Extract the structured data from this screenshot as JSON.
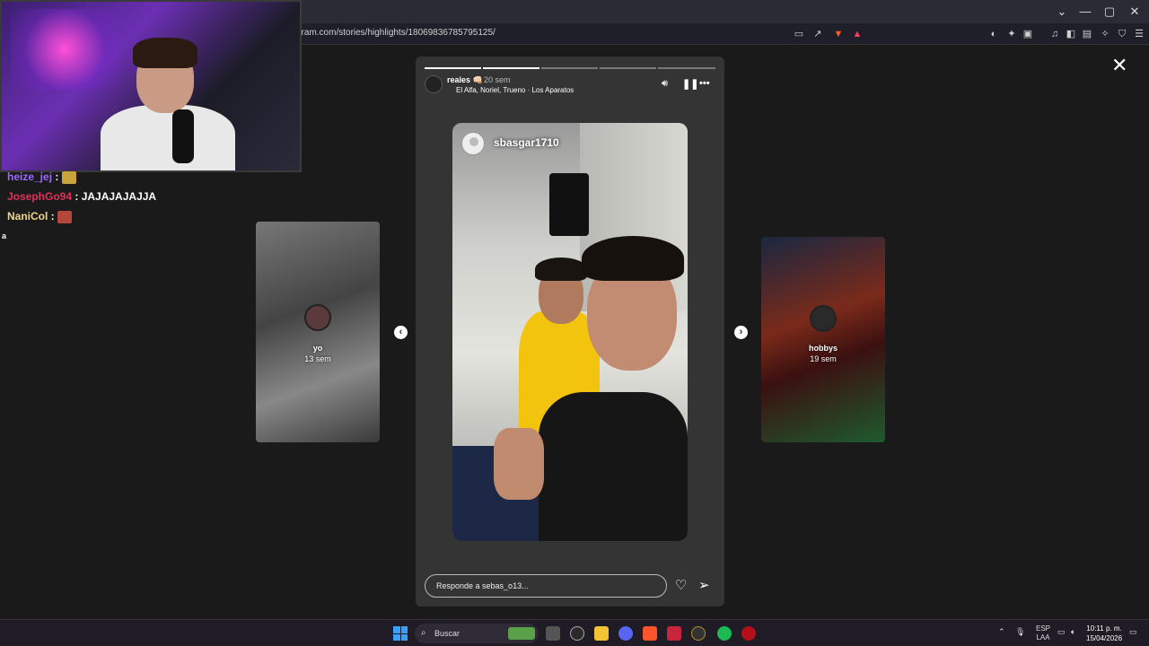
{
  "browser": {
    "url": "gram.com/stories/highlights/18069836785795125/",
    "controls": {
      "minimize": "—",
      "maximize": "▢",
      "close": "✕",
      "chevron": "⌄"
    }
  },
  "chat": [
    {
      "user": "heize_jej",
      "sep": " :",
      "message": ""
    },
    {
      "user": "JosephGo94",
      "sep": " : ",
      "message": "JAJAJAJAJJA"
    },
    {
      "user": "NaniCol",
      "sep": " :",
      "message": ""
    }
  ],
  "chat_stray": "a",
  "story": {
    "user": "reales 👊🏻",
    "time": "20 sem",
    "music": "El Alfa, Noriel, Trueno · Los Aparatos",
    "mention": "sbasgar1710",
    "reply_placeholder": "Responde a sebas_o13...",
    "progress_segments": 5,
    "progress_done": 2
  },
  "side_left": {
    "name": "yo",
    "time": "13 sem"
  },
  "side_right": {
    "name": "hobbys",
    "time": "19 sem"
  },
  "taskbar": {
    "search": "Buscar",
    "lang": "ESP",
    "lang2": "LAA",
    "time": "10:11 p. m.",
    "date": "15/04/2026"
  },
  "colors": {
    "accent": "#3aa0ff",
    "chat_user1": "#9b6bff",
    "chat_user2": "#e0315a",
    "chat_user3": "#f0d58a"
  }
}
